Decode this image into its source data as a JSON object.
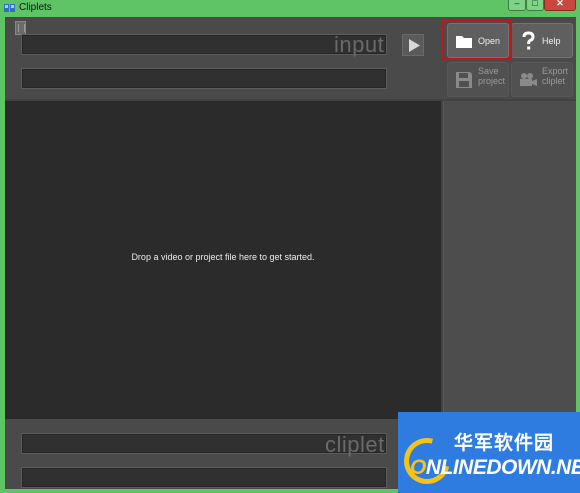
{
  "window": {
    "title": "Cliplets",
    "controls": {
      "minimize": "–",
      "maximize": "□",
      "close": "✕"
    }
  },
  "input_panel": {
    "watermark": "input"
  },
  "output_panel": {
    "watermark": "cliplet"
  },
  "toolbar": {
    "open_label": "Open",
    "help_label": "Help",
    "save_label_1": "Save",
    "save_label_2": "project",
    "export_label_1": "Export",
    "export_label_2": "cliplet"
  },
  "stage": {
    "drop_message": "Drop a video or project file here to get started."
  },
  "site_badge": {
    "chinese": "华军软件园",
    "english_o": "O",
    "english_rest": "NLINEDOWN",
    "english_tld": ".NET"
  },
  "colors": {
    "frame": "#5ec466",
    "highlight": "#c0161b",
    "stage": "#2b2b2b",
    "panel": "#4a4a4a"
  },
  "icons": [
    "app-icon",
    "play-icon",
    "folder-icon",
    "question-icon",
    "floppy-icon",
    "camera-icon"
  ]
}
